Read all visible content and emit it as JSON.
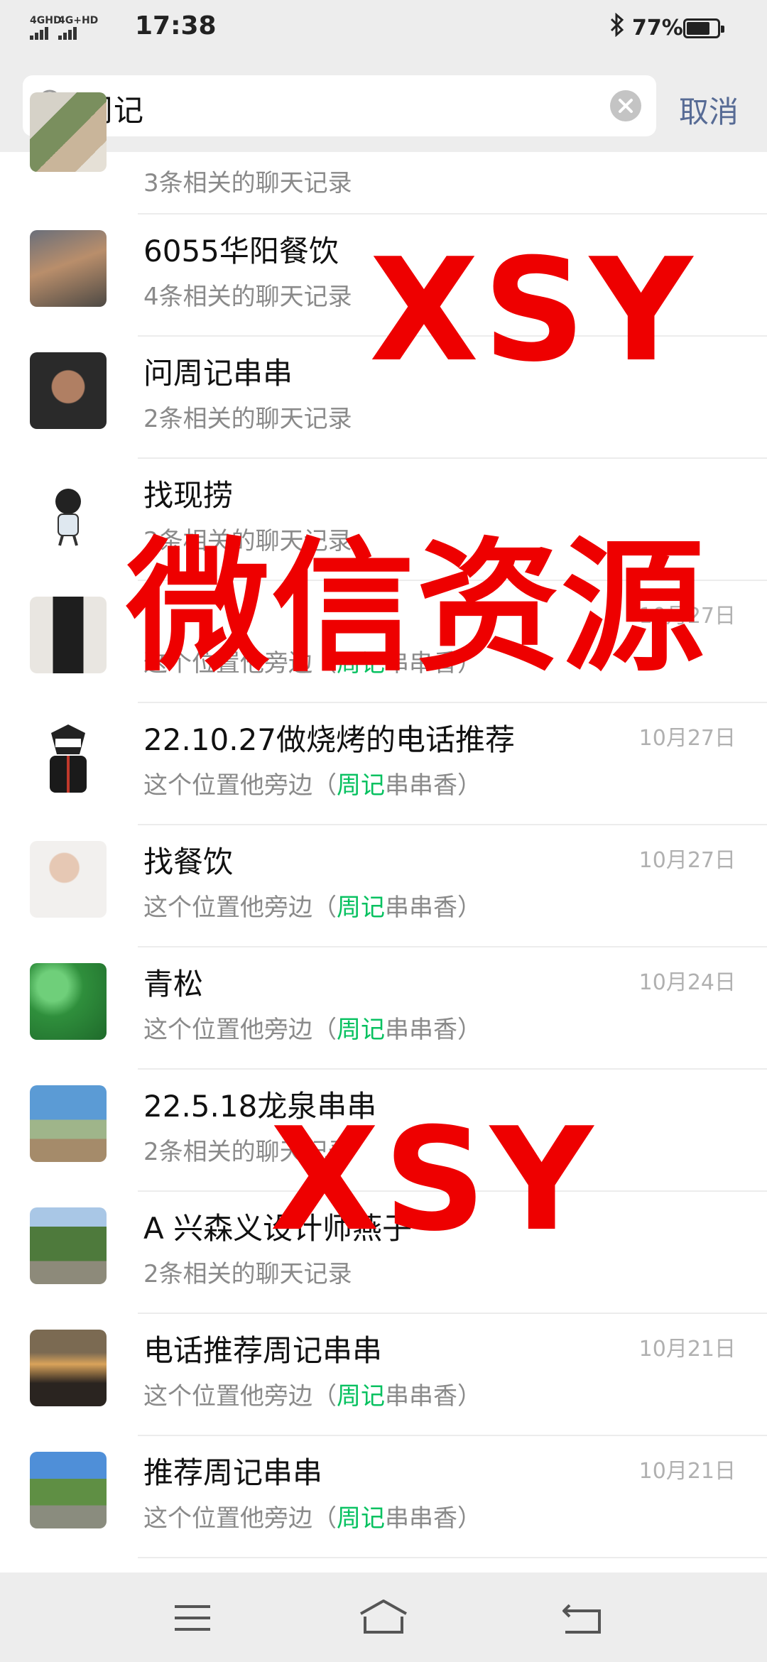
{
  "status_bar": {
    "network_1": "4GHD",
    "network_2": "4G+HD",
    "time": "17:38",
    "bluetooth_icon": "bluetooth-icon",
    "battery_percent": "77%",
    "battery_level": 0.77
  },
  "search": {
    "query": "周记",
    "cancel_label": "取消"
  },
  "results": [
    {
      "title": "",
      "sub_prefix": "3条相关的聊天记录",
      "sub_hl": "",
      "sub_suffix": "",
      "date": ""
    },
    {
      "title": "6055华阳餐饮",
      "sub_prefix": "4条相关的聊天记录",
      "sub_hl": "",
      "sub_suffix": "",
      "date": ""
    },
    {
      "title": "问周记串串",
      "sub_prefix": "2条相关的聊天记录",
      "sub_hl": "",
      "sub_suffix": "",
      "date": ""
    },
    {
      "title": "找现捞",
      "sub_prefix": "2条相关的聊天记录",
      "sub_hl": "",
      "sub_suffix": "",
      "date": ""
    },
    {
      "title": "",
      "sub_prefix": "这个位置他旁边（",
      "sub_hl": "周记",
      "sub_suffix": "串串香）",
      "date": "10月27日"
    },
    {
      "title": "22.10.27做烧烤的电话推荐",
      "sub_prefix": "这个位置他旁边（",
      "sub_hl": "周记",
      "sub_suffix": "串串香）",
      "date": "10月27日"
    },
    {
      "title": "找餐饮",
      "sub_prefix": "这个位置他旁边（",
      "sub_hl": "周记",
      "sub_suffix": "串串香）",
      "date": "10月27日"
    },
    {
      "title": "青松",
      "sub_prefix": "这个位置他旁边（",
      "sub_hl": "周记",
      "sub_suffix": "串串香）",
      "date": "10月24日"
    },
    {
      "title": "22.5.18龙泉串串",
      "sub_prefix": "2条相关的聊天记录",
      "sub_hl": "",
      "sub_suffix": "",
      "date": ""
    },
    {
      "title": "A 兴森义设计师燕子",
      "sub_prefix": "2条相关的聊天记录",
      "sub_hl": "",
      "sub_suffix": "",
      "date": ""
    },
    {
      "title": "电话推荐周记串串",
      "sub_prefix": "这个位置他旁边（",
      "sub_hl": "周记",
      "sub_suffix": "串串香）",
      "date": "10月21日"
    },
    {
      "title": "推荐周记串串",
      "sub_prefix": "这个位置他旁边（",
      "sub_hl": "周记",
      "sub_suffix": "串串香）",
      "date": "10月21日"
    }
  ],
  "watermarks": {
    "top": "XSY",
    "middle": "微信资源",
    "bottom": "XSY"
  },
  "nav": {
    "menu_icon": "menu-icon",
    "home_icon": "home-icon",
    "back_icon": "back-icon"
  }
}
